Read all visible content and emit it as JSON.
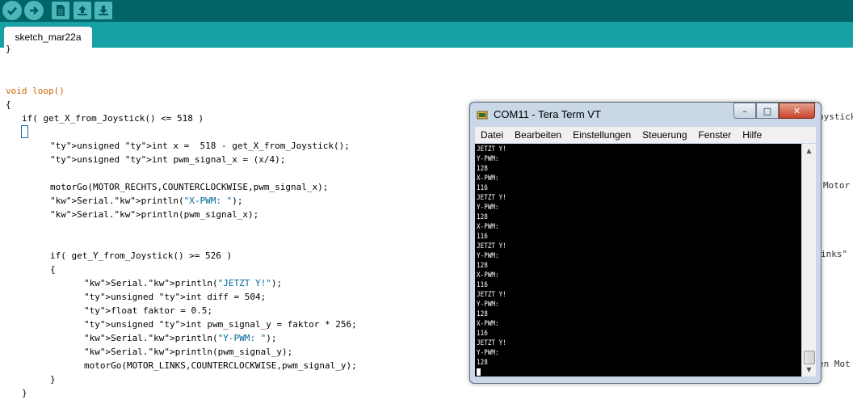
{
  "toolbar": {
    "buttons": [
      {
        "name": "verify",
        "icon": "check-icon"
      },
      {
        "name": "upload",
        "icon": "arrow-right-icon"
      },
      {
        "name": "new",
        "icon": "new-file-icon"
      },
      {
        "name": "open",
        "icon": "open-arrow-up-icon"
      },
      {
        "name": "save",
        "icon": "save-arrow-down-icon"
      }
    ],
    "bg_color": "#006468",
    "accent_color": "#4db7bb"
  },
  "tabs": [
    {
      "label": "sketch_mar22a"
    }
  ],
  "editor": {
    "lines": [
      {
        "text": "}"
      },
      {
        "text": "void loop()"
      },
      {
        "text": "{"
      },
      {
        "text": "if( get_X_from_Joystick() <= 518 )"
      },
      {
        "text": "unsigned int x =  518 - get_X_from_Joystick();"
      },
      {
        "text": "unsigned int pwm_signal_x = (x/4);"
      },
      {
        "text": "motorGo(MOTOR_RECHTS,COUNTERCLOCKWISE,pwm_signal_x);"
      },
      {
        "text": "Serial.println(\"X-PWM: \");"
      },
      {
        "text": "Serial.println(pwm_signal_x);"
      },
      {
        "text": "if( get_Y_from_Joystick() >= 526 )"
      },
      {
        "text": "{"
      },
      {
        "text": "Serial.println(\"JETZT Y!\");"
      },
      {
        "text": "unsigned int diff = 504;"
      },
      {
        "text": "float faktor = 0.5;"
      },
      {
        "text": "unsigned int pwm_signal_y = faktor * 256;"
      },
      {
        "text": "Serial.println(\"Y-PWM: \");"
      },
      {
        "text": "Serial.println(pwm_signal_y);"
      },
      {
        "text": "motorGo(MOTOR_LINKS,COUNTERCLOCKWISE,pwm_signal_y);"
      },
      {
        "text": "}"
      },
      {
        "text": "}"
      }
    ],
    "right_fragments": [
      "oystick",
      "Motor",
      "inks\"",
      "en Mot"
    ]
  },
  "teraterm": {
    "title": "COM11 - Tera Term VT",
    "window_buttons": {
      "minimize": "–",
      "maximize": "□",
      "close": "✕"
    },
    "menu": [
      "Datei",
      "Bearbeiten",
      "Einstellungen",
      "Steuerung",
      "Fenster",
      "Hilfe"
    ],
    "output": [
      "JETZT Y!",
      "Y-PWM:",
      "128",
      "X-PWM:",
      "116",
      "JETZT Y!",
      "Y-PWM:",
      "128",
      "X-PWM:",
      "116",
      "JETZT Y!",
      "Y-PWM:",
      "128",
      "X-PWM:",
      "116",
      "JETZT Y!",
      "Y-PWM:",
      "128",
      "X-PWM:",
      "116",
      "JETZT Y!",
      "Y-PWM:",
      "128"
    ]
  }
}
